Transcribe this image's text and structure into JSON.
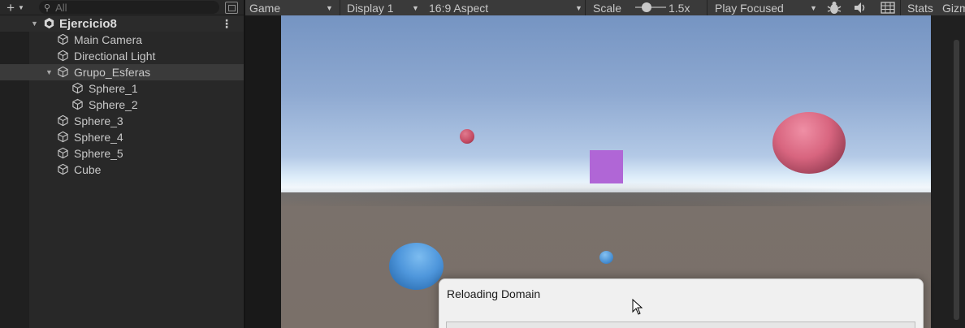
{
  "hierarchy": {
    "search": {
      "placeholder": "All",
      "value": ""
    },
    "add_icon": "plus-icon",
    "scene": {
      "name": "Ejercicio8",
      "icon": "unity-scene-icon"
    },
    "items": [
      {
        "label": "Main Camera",
        "icon": "cube-icon"
      },
      {
        "label": "Directional Light",
        "icon": "cube-icon"
      },
      {
        "label": "Grupo_Esferas",
        "icon": "cube-icon",
        "expanded": true
      },
      {
        "label": "Sphere_1",
        "icon": "cube-icon"
      },
      {
        "label": "Sphere_2",
        "icon": "cube-icon"
      },
      {
        "label": "Sphere_3",
        "icon": "cube-icon"
      },
      {
        "label": "Sphere_4",
        "icon": "cube-icon"
      },
      {
        "label": "Sphere_5",
        "icon": "cube-icon"
      },
      {
        "label": "Cube",
        "icon": "cube-icon"
      }
    ]
  },
  "game_view": {
    "view_select": "Game",
    "display_select": "Display 1",
    "aspect_select": "16:9 Aspect",
    "scale_label": "Scale",
    "scale_value": "1.5x",
    "play_mode_select": "Play Focused",
    "stats_label": "Stats",
    "gizmos_label": "Gizmos",
    "icons": [
      "bug-icon",
      "speaker-icon",
      "grid-icon"
    ]
  },
  "scene_colors": {
    "sky_top": "#7594c2",
    "ground": "#7a716a",
    "pink_sphere": "#d8657f",
    "blue_sphere": "#4f97dc",
    "cube": "#b066d6"
  },
  "dialog": {
    "title": "Reloading Domain",
    "progress": 0
  }
}
